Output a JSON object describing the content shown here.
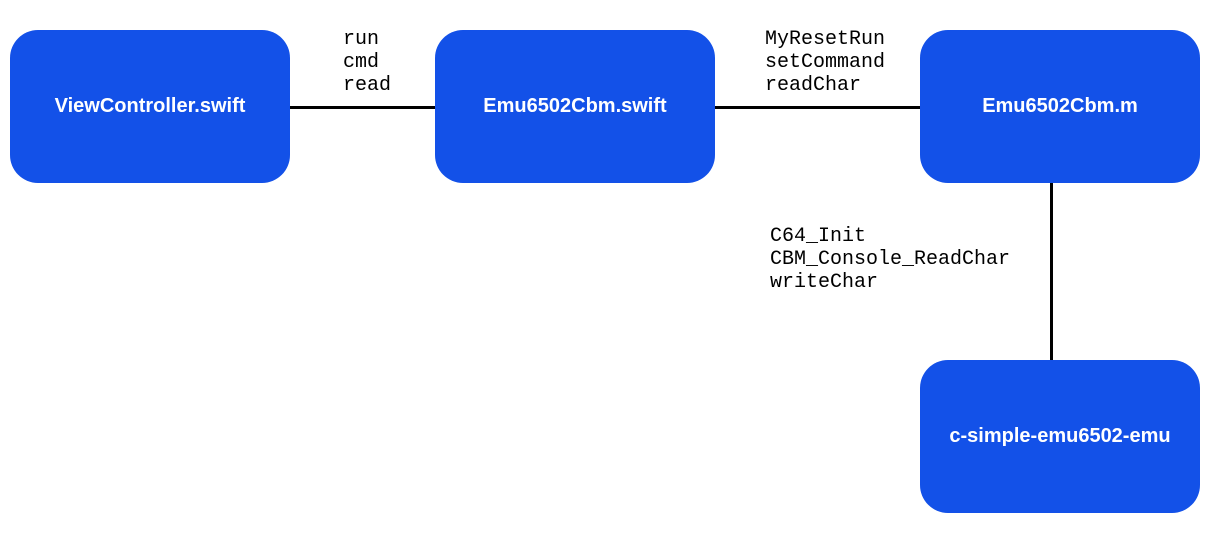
{
  "nodes": {
    "n1": "ViewController.swift",
    "n2": "Emu6502Cbm.swift",
    "n3": "Emu6502Cbm.m",
    "n4": "c-simple-emu6502-emu"
  },
  "edges": {
    "e1": "run\ncmd\nread",
    "e2": "MyResetRun\nsetCommand\nreadChar",
    "e3": "C64_Init\nCBM_Console_ReadChar\nwriteChar"
  }
}
